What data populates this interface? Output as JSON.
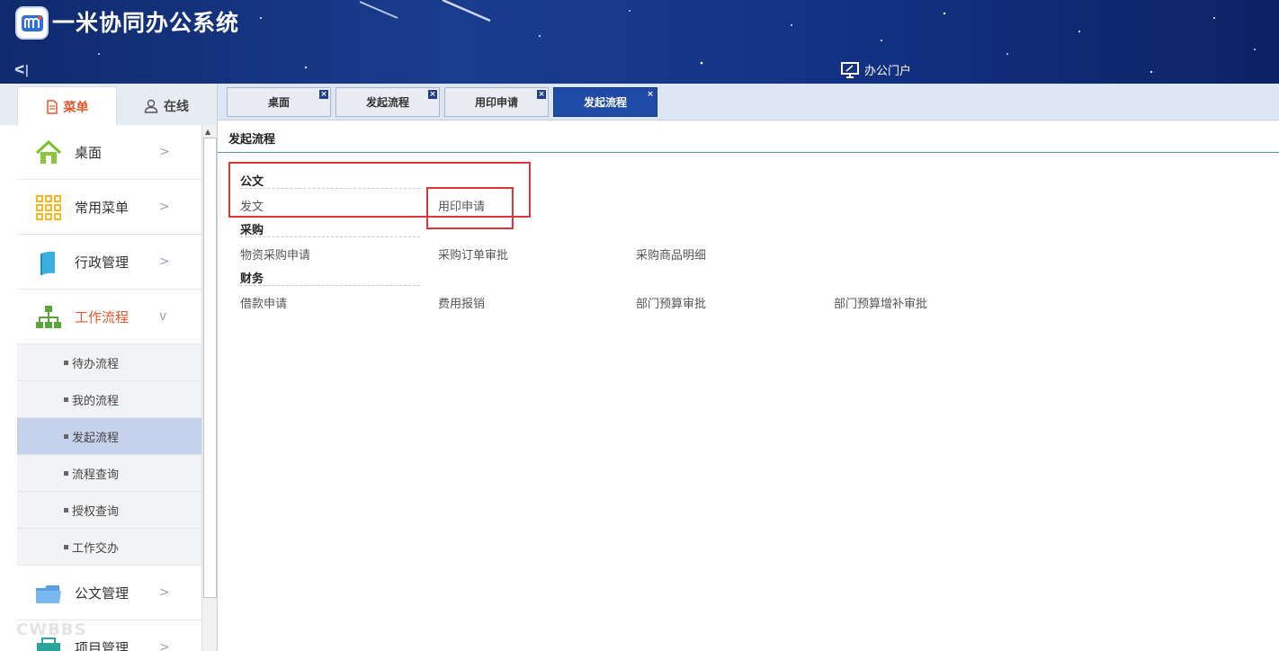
{
  "app": {
    "title": "一米协同办公系统",
    "collapse_glyph": "ᐸ|"
  },
  "header": {
    "portal_label": "办公门户"
  },
  "left_tabs": [
    {
      "label": "菜单",
      "icon": "document-icon",
      "active": true
    },
    {
      "label": "在线",
      "icon": "user-icon",
      "active": false
    }
  ],
  "sidebar": {
    "items": [
      {
        "label": "桌面",
        "icon": "home-icon"
      },
      {
        "label": "常用菜单",
        "icon": "grid-icon"
      },
      {
        "label": "行政管理",
        "icon": "book-icon"
      },
      {
        "label": "工作流程",
        "icon": "org-chart-icon",
        "expanded": true
      },
      {
        "label": "公文管理",
        "icon": "folder-icon"
      },
      {
        "label": "项目管理",
        "icon": "project-icon"
      }
    ],
    "sub_items": [
      {
        "label": "待办流程"
      },
      {
        "label": "我的流程"
      },
      {
        "label": "发起流程",
        "selected": true
      },
      {
        "label": "流程查询"
      },
      {
        "label": "授权查询"
      },
      {
        "label": "工作交办"
      }
    ]
  },
  "tabs": [
    {
      "label": "桌面"
    },
    {
      "label": "发起流程"
    },
    {
      "label": "用印申请"
    },
    {
      "label": "发起流程",
      "active": true
    }
  ],
  "content": {
    "title": "发起流程",
    "categories": [
      {
        "name": "公文",
        "flows": [
          "发文",
          "用印申请"
        ]
      },
      {
        "name": "采购",
        "flows": [
          "物资采购申请",
          "采购订单审批",
          "采购商品明细"
        ]
      },
      {
        "name": "财务",
        "flows": [
          "借款申请",
          "费用报销",
          "部门预算审批",
          "部门预算增补审批"
        ]
      }
    ]
  },
  "watermark": "CWBBS",
  "colors": {
    "accent": "#e0582c",
    "header": "#14348a",
    "active_tab": "#1f4aa6",
    "annotation": "#d9373a"
  }
}
